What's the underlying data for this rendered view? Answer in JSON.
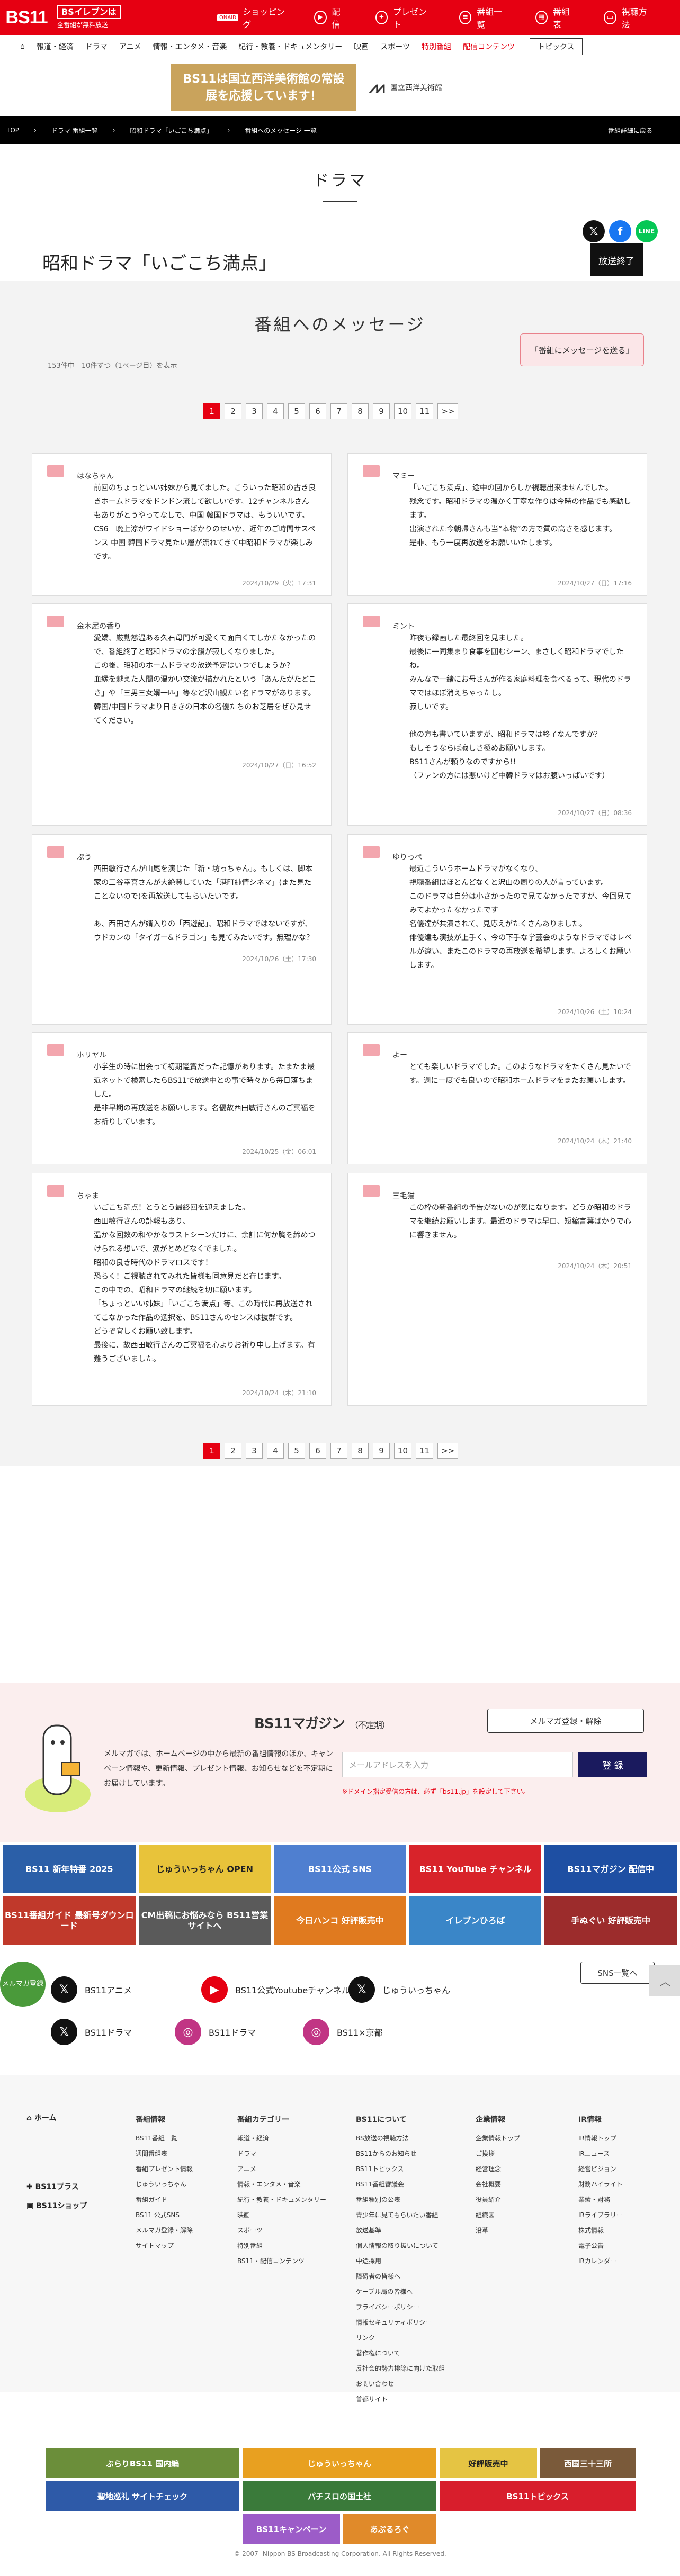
{
  "header": {
    "logo": "BS11",
    "logo_tagline_1": "BSイレブンは",
    "logo_tagline_2": "全番組が無料放送",
    "nav": [
      {
        "label": "ショッピング",
        "tag": "ONAIR"
      },
      {
        "label": "配信",
        "tag": ""
      },
      {
        "label": "プレゼント",
        "tag": ""
      },
      {
        "label": "番組一覧",
        "tag": ""
      },
      {
        "label": "番組表",
        "tag": ""
      },
      {
        "label": "視聴方法",
        "tag": ""
      }
    ]
  },
  "categories": [
    "報道・経済",
    "ドラマ",
    "アニメ",
    "情報・エンタメ・音楽",
    "紀行・教養・ドキュメンタリー",
    "映画",
    "スポーツ",
    "特別番組",
    "配信コンテンツ"
  ],
  "topics_label": "トピックス",
  "banner": {
    "left": "BS11は国立西洋美術館の常設展を応援しています！",
    "right": "国立西洋美術館"
  },
  "breadcrumb": [
    "TOP",
    "ドラマ 番組一覧",
    "昭和ドラマ「いごこち満点」",
    "番組へのメッセージ 一覧"
  ],
  "back_label": "番組詳細に戻る",
  "section_title": "ドラマ",
  "program_title": "昭和ドラマ「いごこち満点」",
  "ended_label": "放送終了",
  "messages_title": "番組へのメッセージ",
  "send_label": "「番組にメッセージを送る」",
  "count_text": "153件中　10件ずつ（1ページ目）を表示",
  "pager": [
    "1",
    "2",
    "3",
    "4",
    "5",
    "6",
    "7",
    "8",
    "9",
    "10",
    "11",
    ">>"
  ],
  "messages": [
    {
      "name": "はなちゃん",
      "body": "前回のちょっといい姉妹から見てました。こういった昭和の古き良きホームドラマをドンドン流して欲しいです。12チャンネルさんもありがとうやってなしで、中国 韓国ドラマは、もういいです。CS6　晩上涼がワイドショーばかりのせいか、近年のご時間サスペンス 中国 韓国ドラマ見たい層が流れてきて中昭和ドラマが楽しみです。",
      "date": "2024/10/29（火）17:31"
    },
    {
      "name": "マミー",
      "body": "「いごこち満点」、途中の回からしか視聴出来ませんでした。\n残念です。昭和ドラマの温かく丁寧な作りは今時の作品でも感動します。\n出演された今朝帰さんも当“本物”の方で質の高さを感じます。\n是非、もう一度再放送をお願いいたします。",
      "date": "2024/10/27（日）17:16"
    },
    {
      "name": "金木犀の香り",
      "body": "愛嬌、厳動慈温ある久石母門が可愛くて面白くてしかたなかったので、番組終了と昭和ドラマの余韻が寂しくなりました。\nこの後、昭和のホームドラマの放送予定はいつでしょうか？\n血縁を越えた人間の温かい交流が描かれたという「あんたがたどこさ」や「三男三女婿一匹」等など沢山観たい名ドラマがあります。\n韓国/中国ドラマより日ききの日本の名優たちのお芝居をぜひ見せてください。",
      "date": "2024/10/27（日）16:52"
    },
    {
      "name": "ミント",
      "body": "昨夜も録画した最終回を見ました。\n最後に一同集まり食事を囲むシーン、まさしく昭和ドラマでしたね。\nみんなで一緒にお母さんが作る家庭料理を食べるって、現代のドラマではほぼ消えちゃったし。\n寂しいです。\n\n他の方も書いていますが、昭和ドラマは終了なんですか？\nもしそうならば寂しさ極めお願いします。\nBS11さんが頼りなのですから!!\n（ファンの方には悪いけど中韓ドラマはお腹いっぱいです）",
      "date": "2024/10/27（日）08:36"
    },
    {
      "name": "ぷう",
      "body": "西田敏行さんが山尾を演じた「新・坊っちゃん」。もしくは、脚本家の三谷幸喜さんが大絶賛していた「港町純情シネマ」(また見たことないので)を再放送してもらいたいです。\n\nあ、西田さんが婿入りの「西遊記」、昭和ドラマではないですが、ウドカンの「タイガー&ドラゴン」も見てみたいです。無理かな？",
      "date": "2024/10/26（土）17:30"
    },
    {
      "name": "ゆりっぺ",
      "body": "最近こういうホームドラマがなくなり、\n視聴番組はほとんどなくと沢山の周りの人が言っています。\nこのドラマは自分は小さかったので見てなかったですが、今回見てみてよかったなかったです\n名優達が共演されて、見応えがたくさんありました。\n俳優達も演技が上手く、今の下手な学芸会のようなドラマではレベルが違い、またこのドラマの再放送を希望します。よろしくお願いします。",
      "date": "2024/10/26（土）10:24"
    },
    {
      "name": "ホリヤル",
      "body": "小学生の時に出会って初期鑑賞だった記憶があります。たまたま最近ネットで検索したらBS11で放送中との事で時々から毎日落ちました。\n是非早期の再放送をお願いします。名優故西田敏行さんのご冥福をお祈りしています。",
      "date": "2024/10/25（金）06:01"
    },
    {
      "name": "よー",
      "body": "とても楽しいドラマでした。このようなドラマをたくさん見たいです。週に一度でも良いので昭和ホームドラマをまたお願いします。",
      "date": "2024/10/24（木）21:40"
    },
    {
      "name": "ちゃま",
      "body": "いごこち満点！とうとう最終回を迎えました。\n西田敏行さんの訃報もあり、\n温かな回数の和やかなラストシーンだけに、余計に何か胸を締めつけられる想いで、涙がとめどなくでました。\n昭和の良き時代のドラマロスです！\n恐らく！ご視聴されてみれた皆様も同意見だと存じます。\nこの中での、昭和ドラマの継続を切に願います。\n「ちょっといい姉妹」「いごこち満点」等、この時代に再放送されてこなかった作品の選択を、BS11さんのセンスは抜群です。\nどうぞ宜しくお願い致します。\n最後に、故西田敏行さんのご冥福を心よりお祈り申し上げます。有難うございました。",
      "date": "2024/10/24（木）21:10"
    },
    {
      "name": "三毛猫",
      "body": "この枠の新番組の予告がないのが気になります。どうか昭和のドラマを継続お願いします。最近のドラマは早口、短縮言葉ばかりで心に響きません。",
      "date": "2024/10/24（木）20:51"
    }
  ],
  "newsletter": {
    "title": "BS11マガジン",
    "subtitle": "（不定期）",
    "register": "メルマガ登録・解除",
    "text": "メルマガでは、ホームページの中から最新の番組情報のほか、キャンペーン情報や、更新情報、プレゼント情報、お知らせなどを不定期にお届けしています。",
    "placeholder": "メールアドレスを入力",
    "button": "登 録",
    "note": "※ドメイン指定受信の方は、必ず「bs11.jp」を設定して下さい。"
  },
  "promo_banners": [
    "BS11 新年特番 2025",
    "じゅういっちゃん OPEN",
    "BS11公式 SNS",
    "BS11 YouTube チャンネル",
    "BS11マガジン 配信中",
    "BS11番組ガイド 最新号ダウンロード",
    "CM出稿にお悩みなら BS11営業サイトへ",
    "今日ハンコ 好評販売中",
    "イレブンひろば",
    "手ぬぐい 好評販売中"
  ],
  "sns": {
    "items": [
      "BS11アニメ",
      "BS11公式Youtubeチャンネル",
      "じゅういっちゃん",
      "BS11ドラマ",
      "BS11ドラマ",
      "BS11×京都"
    ],
    "list_label": "SNS一覧へ",
    "mail_badge": "メルマガ登録"
  },
  "footer": {
    "side": [
      "ホーム",
      "BS11プラス",
      "BS11ショップ"
    ],
    "cols": [
      {
        "head": "番組情報",
        "items": [
          "BS11番組一覧",
          "週間番組表",
          "番組プレゼント情報",
          "じゅういっちゃん",
          "番組ガイド",
          "BS11 公式SNS",
          "メルマガ登録・解除",
          "サイトマップ"
        ]
      },
      {
        "head": "番組カテゴリー",
        "items": [
          "報道・経済",
          "ドラマ",
          "アニメ",
          "情報・エンタメ・音楽",
          "紀行・教養・ドキュメンタリー",
          "映画",
          "スポーツ",
          "特別番組",
          "BS11・配信コンテンツ"
        ]
      },
      {
        "head": "BS11について",
        "items": [
          "BS放送の視聴方法",
          "BS11からのお知らせ",
          "BS11トピックス",
          "BS11番組審議会",
          "番組種別の公表",
          "青少年に見てもらいたい番組",
          "放送基準",
          "個人情報の取り扱いについて",
          "中途採用",
          "障碍者の皆様へ",
          "ケーブル局の皆様へ",
          "プライバシーポリシー",
          "情報セキュリティポリシー",
          "リンク",
          "著作権について",
          "反社会的勢力排除に向けた取組",
          "お問い合わせ",
          "首都サイト"
        ]
      },
      {
        "head": "企業情報",
        "items": [
          "企業情報トップ",
          "ご挨拶",
          "経営理念",
          "会社概要",
          "役員紹介",
          "組織図",
          "沿革"
        ]
      },
      {
        "head": "IR情報",
        "items": [
          "IR情報トップ",
          "IRニュース",
          "経営ビジョン",
          "財務ハイライト",
          "業績・財務",
          "IRライブラリー",
          "株式情報",
          "電子公告",
          "IRカレンダー"
        ]
      }
    ],
    "banners": [
      "ぶらりBS11 国内編",
      "じゅういっちゃん",
      "好評販売中",
      "西国三十三所",
      "聖地巡礼 サイトチェック",
      "パチスロの国土社",
      "BS11トピックス",
      "BS11キャンペーン",
      "あぷるろぐ"
    ],
    "copyright": "© 2007- Nippon BS Broadcasting Corporation. All Rights Reserved."
  }
}
